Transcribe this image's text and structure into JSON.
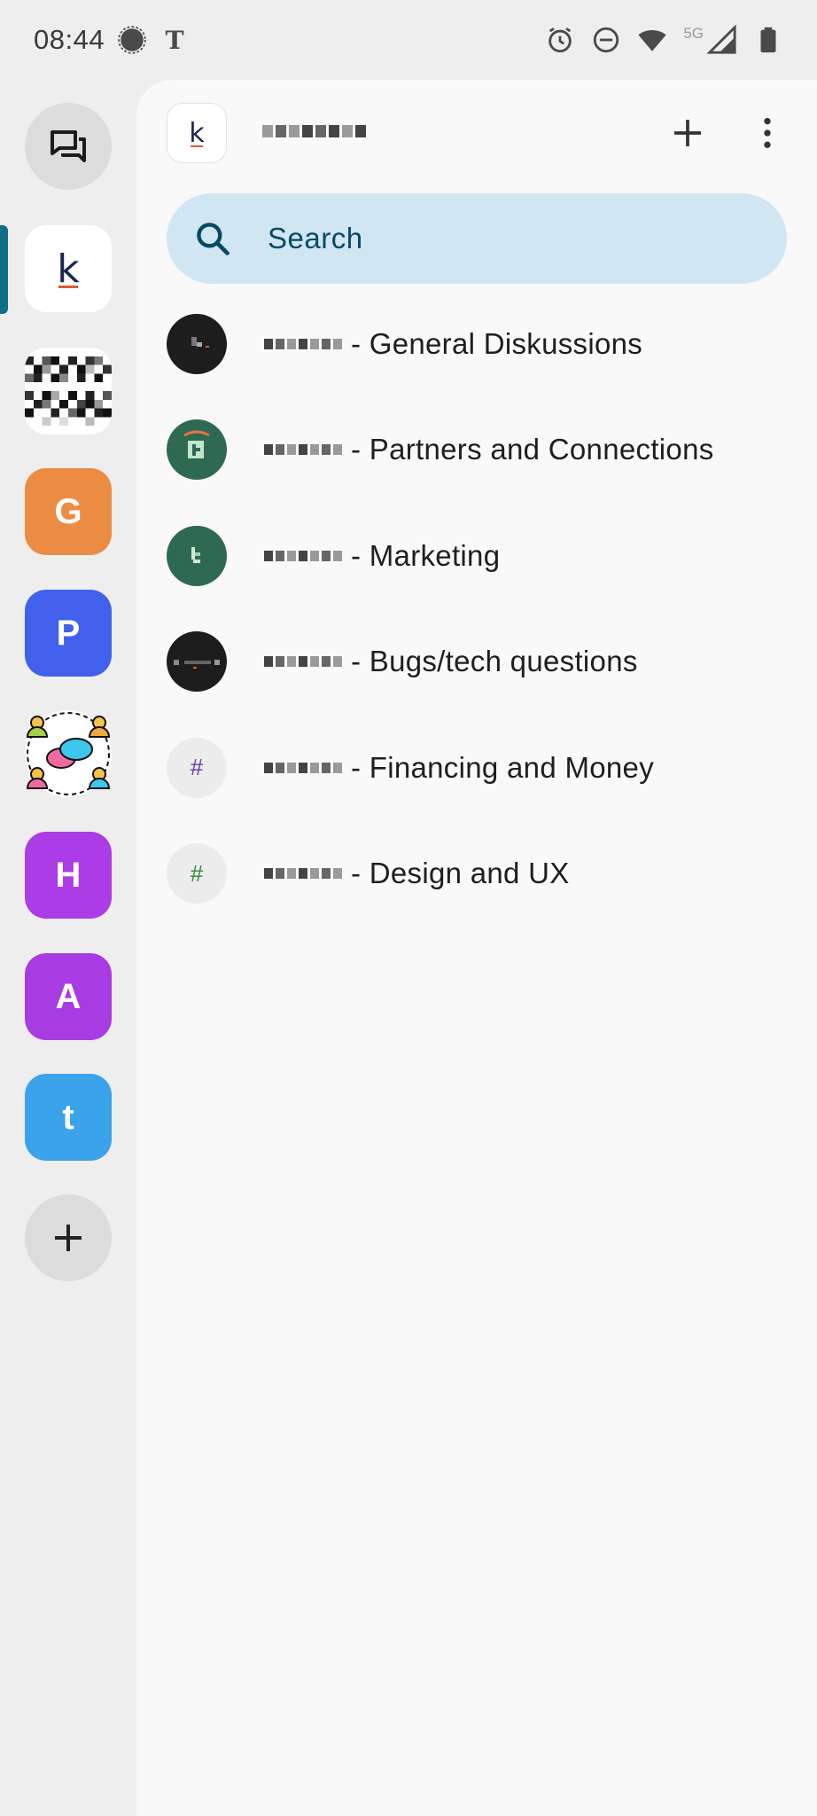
{
  "status_bar": {
    "time": "08:44",
    "network_label": "5G",
    "icons": [
      "signal-app-icon",
      "nyt-icon",
      "alarm-icon",
      "dnd-icon",
      "wifi-icon",
      "cell-signal-icon",
      "battery-icon"
    ]
  },
  "rail": {
    "items": [
      {
        "name": "chats",
        "icon": "chat-bubbles-icon"
      },
      {
        "name": "k-space",
        "label": "k",
        "selected": true
      },
      {
        "name": "pixel-space"
      },
      {
        "name": "g-space",
        "label": "G",
        "color": "#ec8c43"
      },
      {
        "name": "p-space",
        "label": "P",
        "color": "#4160ec"
      },
      {
        "name": "community-space",
        "icon": "community-icon"
      },
      {
        "name": "h-space",
        "label": "H",
        "color": "#ac3ce6"
      },
      {
        "name": "a-space",
        "label": "A",
        "color": "#a93be2"
      },
      {
        "name": "t-space",
        "label": "t",
        "color": "#3ba2ec"
      },
      {
        "name": "add-space",
        "label": "+"
      }
    ]
  },
  "header": {
    "space_avatar_label": "k"
  },
  "search": {
    "placeholder": "Search"
  },
  "rooms": [
    {
      "suffix": "- General Diskussions",
      "avatar": "dark"
    },
    {
      "suffix": "- Partners and Connections",
      "avatar": "green"
    },
    {
      "suffix": "- Marketing",
      "avatar": "green"
    },
    {
      "suffix": "- Bugs/tech questions",
      "avatar": "dark"
    },
    {
      "suffix": "- Financing and Money",
      "avatar": "hash",
      "avatar_label": "#"
    },
    {
      "suffix": "- Design and UX",
      "avatar": "hash",
      "avatar_label": "#"
    }
  ],
  "colors": {
    "accent": "#0f6d86",
    "search_bg": "#d0e6f3",
    "search_text": "#074a64"
  }
}
